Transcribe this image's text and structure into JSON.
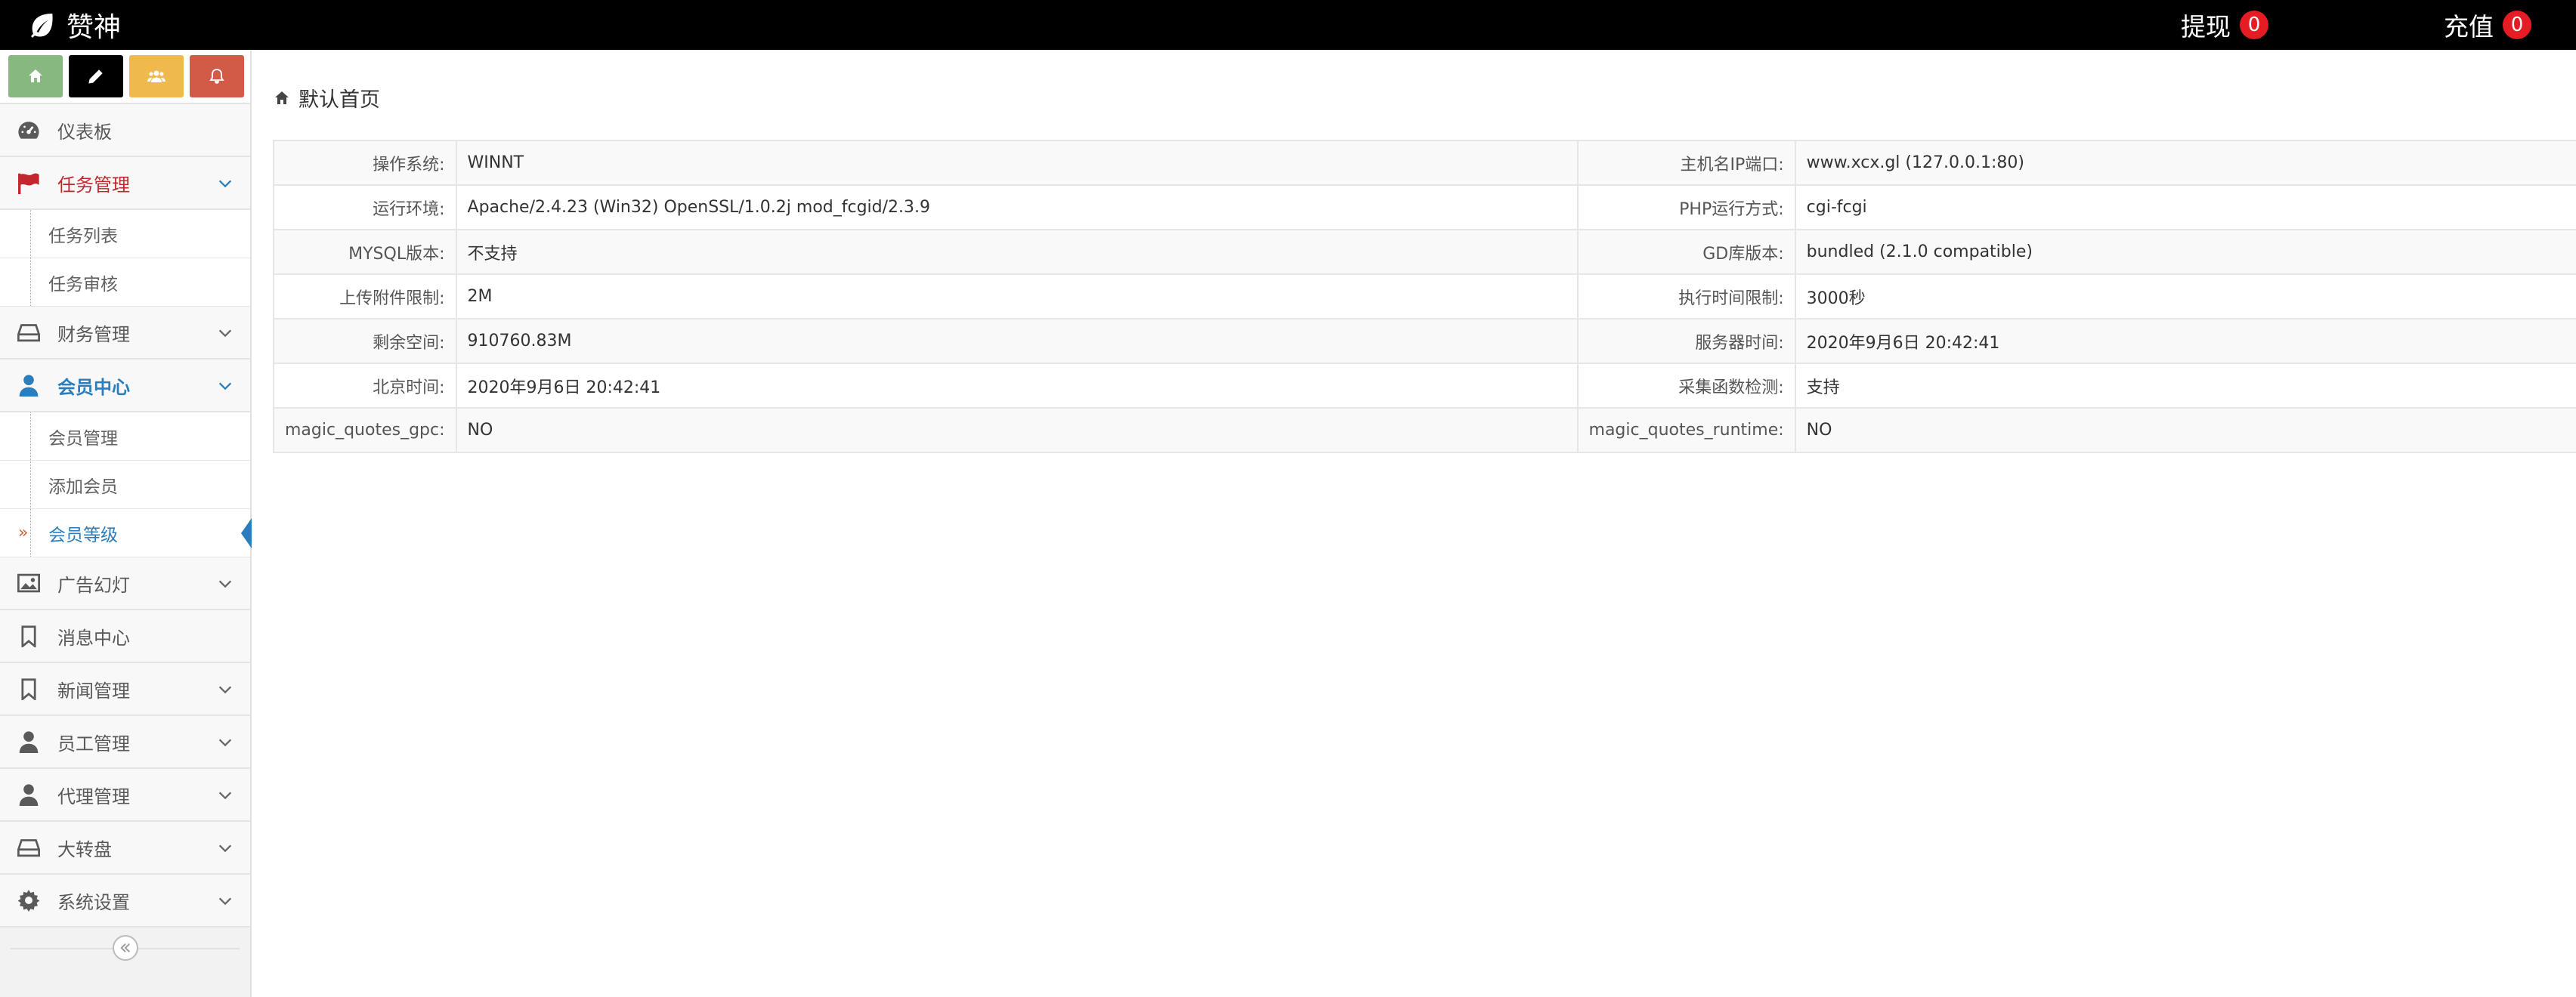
{
  "brand": {
    "name": "赞神",
    "icon": "leaf-icon"
  },
  "top_nav": {
    "withdraw": {
      "label": "提现",
      "count": "0"
    },
    "recharge": {
      "label": "充值",
      "count": "0"
    }
  },
  "shortcuts": [
    {
      "icon": "home-icon",
      "color": "#87b87f"
    },
    {
      "icon": "pencil-icon",
      "color": "#000000"
    },
    {
      "icon": "users-icon",
      "color": "#f0b94e"
    },
    {
      "icon": "bell-icon",
      "color": "#d15b47"
    }
  ],
  "sidebar": {
    "dashboard": "仪表板",
    "task_mgmt": "任务管理",
    "task_list": "任务列表",
    "task_review": "任务审核",
    "finance": "财务管理",
    "member_center": "会员中心",
    "member_mgmt": "会员管理",
    "add_member": "添加会员",
    "member_level": "会员等级",
    "ad_slides": "广告幻灯",
    "message_center": "消息中心",
    "news_mgmt": "新闻管理",
    "staff_mgmt": "员工管理",
    "agent_mgmt": "代理管理",
    "lucky_wheel": "大转盘",
    "settings": "系统设置"
  },
  "breadcrumb": {
    "label": "默认首页",
    "icon": "home-icon"
  },
  "server_info": [
    {
      "k1": "操作系统:",
      "v1": "WINNT",
      "k2": "主机名IP端口:",
      "v2": "www.xcx.gl (127.0.0.1:80)"
    },
    {
      "k1": "运行环境:",
      "v1": "Apache/2.4.23 (Win32) OpenSSL/1.0.2j mod_fcgid/2.3.9",
      "k2": "PHP运行方式:",
      "v2": "cgi-fcgi"
    },
    {
      "k1": "MYSQL版本:",
      "v1": "不支持",
      "k2": "GD库版本:",
      "v2": "bundled (2.1.0 compatible)"
    },
    {
      "k1": "上传附件限制:",
      "v1": "2M",
      "k2": "执行时间限制:",
      "v2": "3000秒"
    },
    {
      "k1": "剩余空间:",
      "v1": "910760.83M",
      "k2": "服务器时间:",
      "v2": "2020年9月6日 20:42:41"
    },
    {
      "k1": "北京时间:",
      "v1": "2020年9月6日 20:42:41",
      "k2": "采集函数检测:",
      "v2": "支持"
    },
    {
      "k1": "magic_quotes_gpc:",
      "v1": "NO",
      "k2": "magic_quotes_runtime:",
      "v2": "NO"
    }
  ]
}
